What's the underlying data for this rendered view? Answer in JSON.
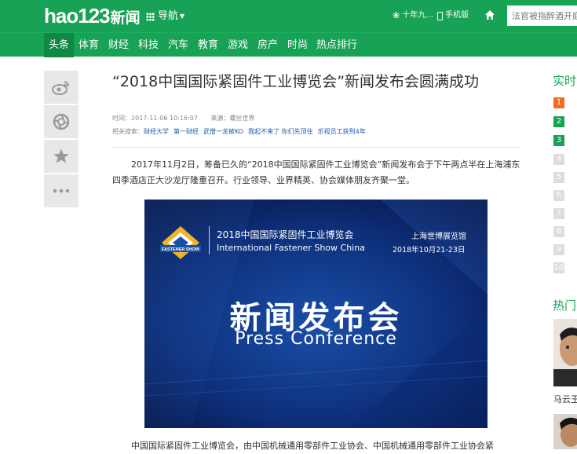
{
  "header": {
    "logo_text": "hao123",
    "logo_sub": "新闻",
    "guide_label": "导航",
    "weather_label": "十年九...",
    "mobile_label": "手机版",
    "search_placeholder": "法官被指醉酒开庭"
  },
  "nav": {
    "items": [
      "头条",
      "体育",
      "财经",
      "科技",
      "汽车",
      "教育",
      "游戏",
      "房产",
      "时尚",
      "热点排行"
    ],
    "active": "头条"
  },
  "share": {
    "icons": [
      "weibo-icon",
      "camera-icon",
      "star-icon",
      "more-icon"
    ]
  },
  "article": {
    "title": "“2018中国国际紧固件工业博览会”新闻发布会圆满成功",
    "time_label": "时间：",
    "time": "2017-11-06 10:16:07",
    "source_label": "来源：",
    "source": "螺丝世界",
    "related_label": "相关搜索：",
    "related": [
      "财经大学",
      "第一财经",
      "武僧一龙被KO",
      "我起不来了 你们先顶住",
      "乐视员工获刑4年"
    ],
    "para1": "2017年11月2日，筹备已久的“2018中国国际紧固件工业博览会”新闻发布会于下午两点半在上海浦东四季酒店正大沙龙厅隆重召开。行业领导、业界精英、协会媒体朋友齐聚一堂。",
    "para2": "中国国际紧固件工业博览会，由中国机械通用零部件工业协会、中国机械通用零部件工业协会紧"
  },
  "banner": {
    "logo_text": "FASTENER SHOW",
    "title_cn": "2018中国国际紧固件工业博览会",
    "title_en": "International Fastener Show China",
    "venue": "上海世博展览馆",
    "date": "2018年10月21-23日",
    "big_cn": "新闻发布会",
    "big_en": "Press Conference"
  },
  "sidebar": {
    "realtime_title": "实时",
    "ranks": [
      "1",
      "2",
      "3",
      "4",
      "5",
      "6",
      "7",
      "8",
      "9",
      "10"
    ],
    "hot_title": "热门",
    "hot_caption": "马云王"
  },
  "colors": {
    "brand_green": "#17a255",
    "active_tab": "#108744",
    "rank_top": "#f26b1f",
    "link_blue": "#1b5fa8"
  }
}
